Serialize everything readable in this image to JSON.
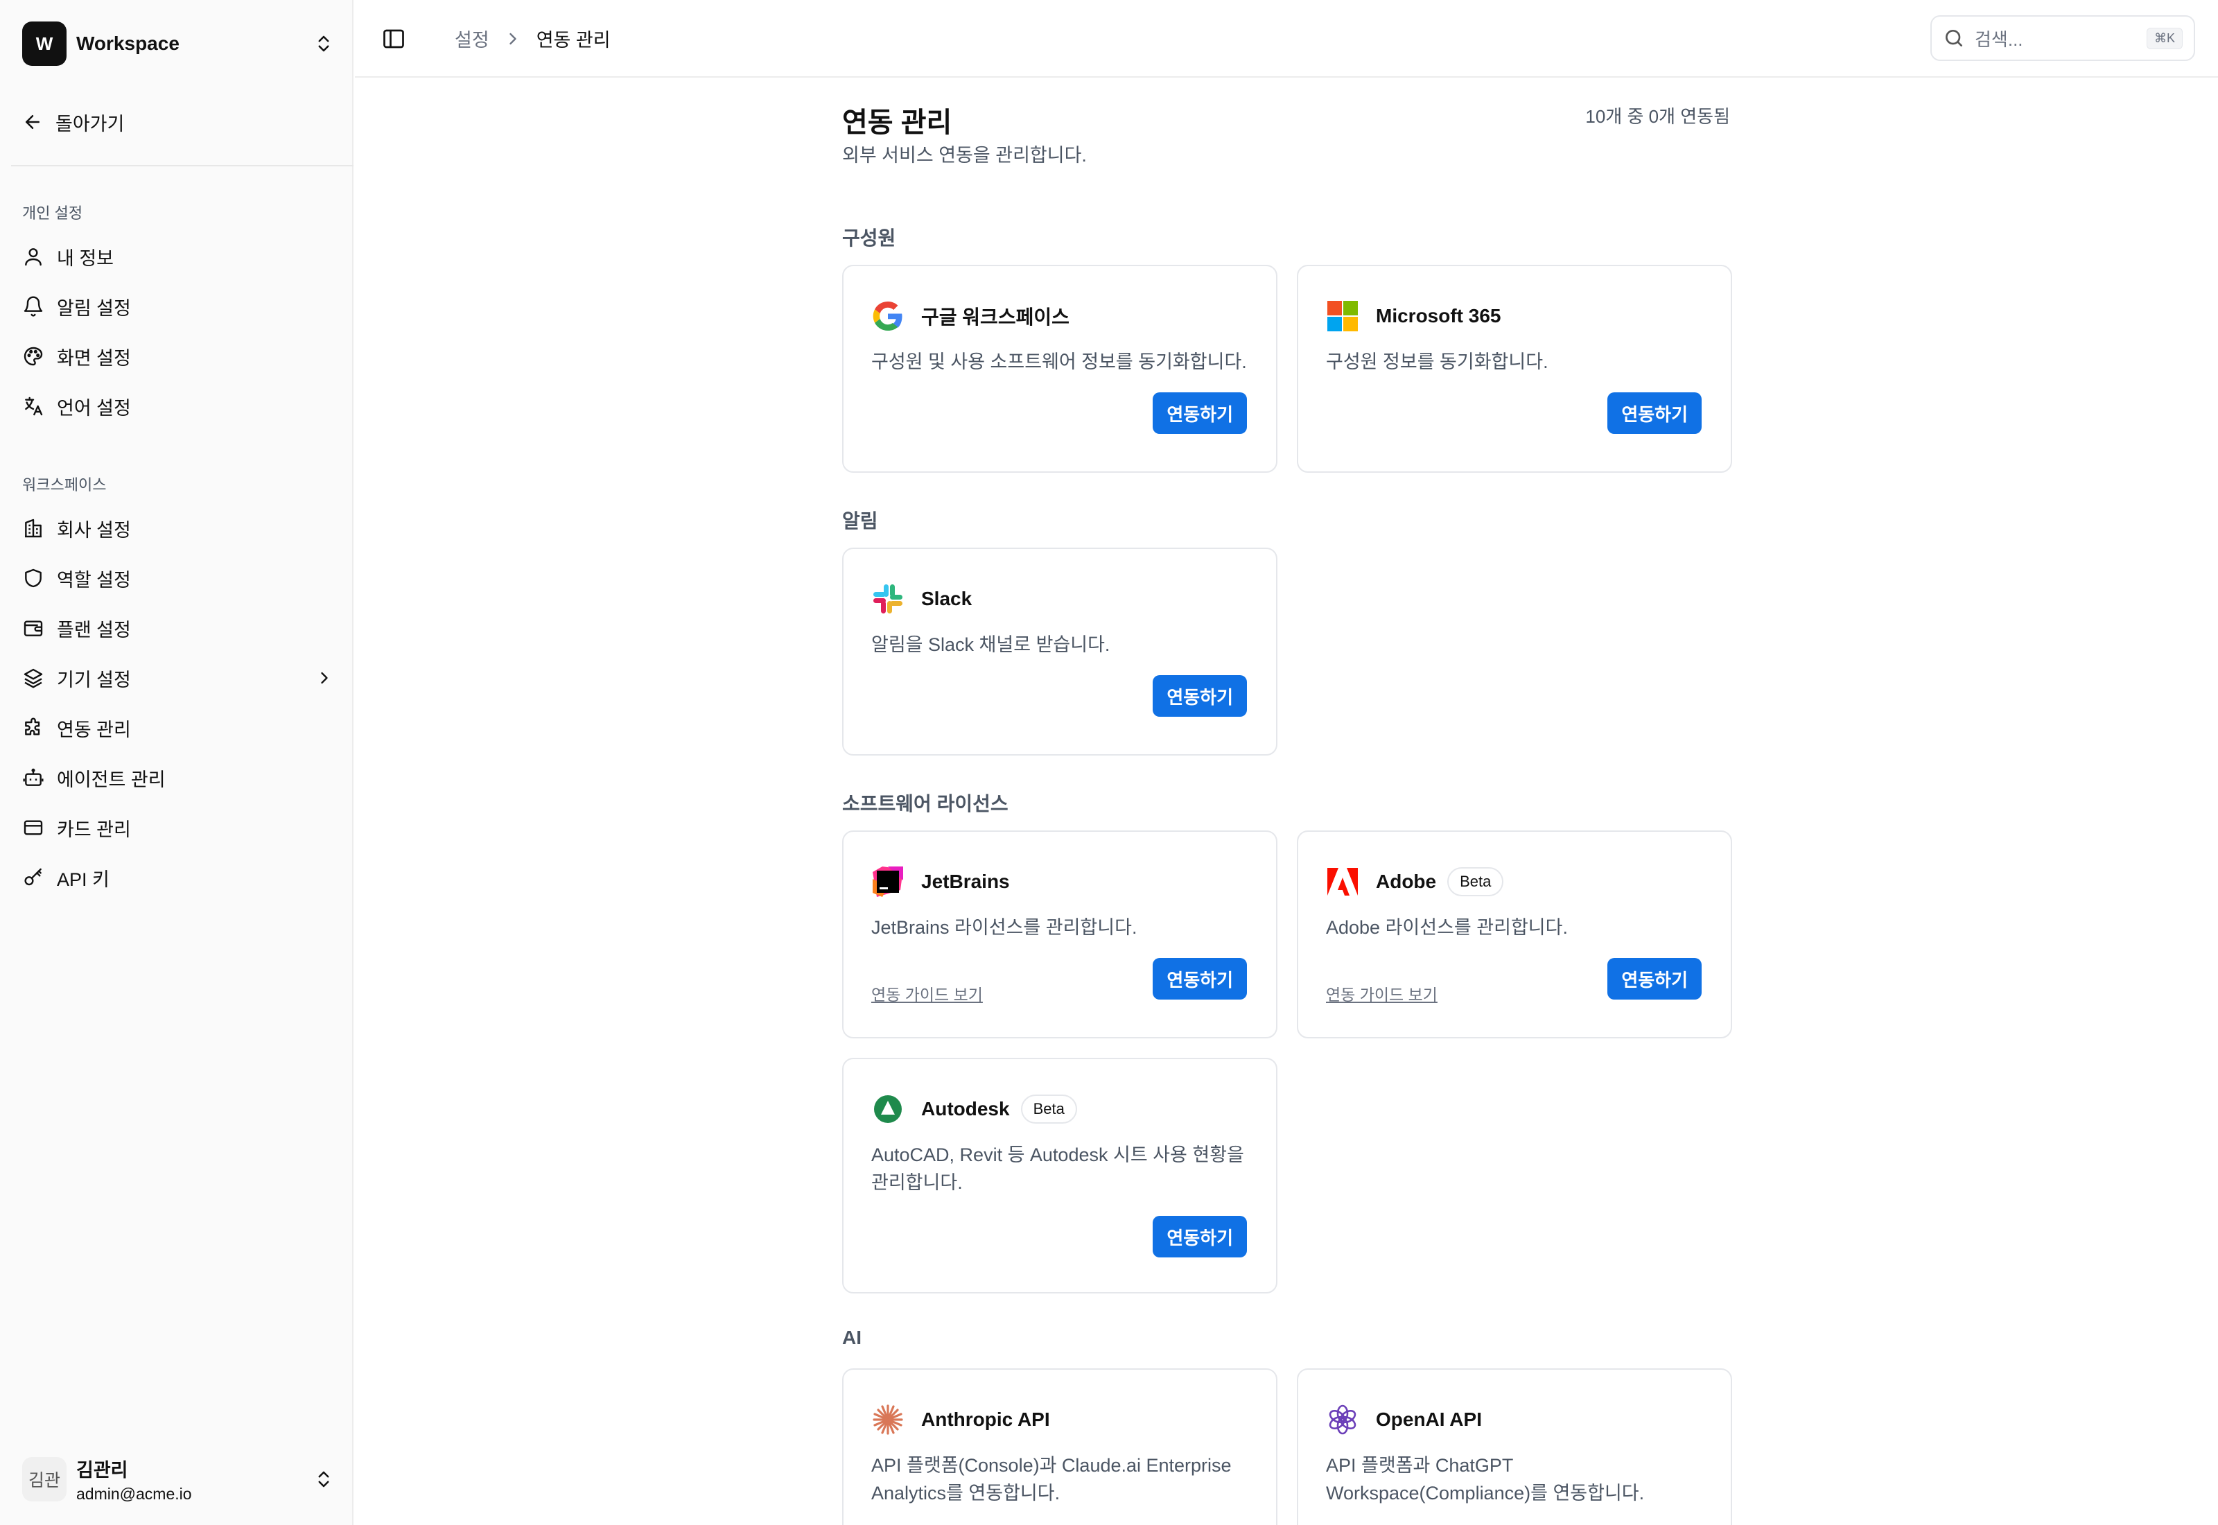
{
  "workspace": {
    "logo_letter": "W",
    "name": "Workspace"
  },
  "sidebar": {
    "back_label": "돌아가기",
    "personal_group": "개인 설정",
    "personal_items": [
      {
        "label": "내 정보",
        "icon": "user-icon"
      },
      {
        "label": "알림 설정",
        "icon": "bell-icon"
      },
      {
        "label": "화면 설정",
        "icon": "palette-icon"
      },
      {
        "label": "언어 설정",
        "icon": "language-icon"
      }
    ],
    "workspace_group": "워크스페이스",
    "workspace_items": [
      {
        "label": "회사 설정",
        "icon": "building-icon"
      },
      {
        "label": "역할 설정",
        "icon": "shield-icon"
      },
      {
        "label": "플랜 설정",
        "icon": "wallet-icon"
      },
      {
        "label": "기기 설정",
        "icon": "layers-icon"
      },
      {
        "label": "연동 관리",
        "icon": "puzzle-icon"
      },
      {
        "label": "에이전트 관리",
        "icon": "bot-icon"
      },
      {
        "label": "카드 관리",
        "icon": "credit-card-icon"
      },
      {
        "label": "API 키",
        "icon": "key-icon"
      }
    ],
    "user": {
      "avatar_text": "김관",
      "name": "김관리",
      "email": "admin@acme.io"
    }
  },
  "header": {
    "breadcrumb": [
      "설정",
      "연동 관리"
    ],
    "search_placeholder": "검색...",
    "search_shortcut": "⌘K"
  },
  "main": {
    "title": "연동 관리",
    "subtitle": "외부 서비스 연동을 관리합니다.",
    "count_text": "10개 중 0개 연동됨",
    "sections": [
      "구성원",
      "알림",
      "소프트웨어 라이선스",
      "AI"
    ],
    "connect_label": "연동하기",
    "guide_label": "연동 가이드 보기",
    "beta_label": "Beta",
    "cards": [
      {
        "name": "구글 워크스페이스",
        "desc": "구성원 및 사용 소프트웨어 정보를 동기화합니다.",
        "icon": "google-icon"
      },
      {
        "name": "Microsoft 365",
        "desc": "구성원 정보를 동기화합니다.",
        "icon": "microsoft-icon"
      },
      {
        "name": "Slack",
        "desc": "알림을 Slack 채널로 받습니다.",
        "icon": "slack-icon"
      },
      {
        "name": "JetBrains",
        "desc": "JetBrains 라이선스를 관리합니다.",
        "icon": "jetbrains-icon"
      },
      {
        "name": "Adobe",
        "desc": "Adobe 라이선스를 관리합니다.",
        "icon": "adobe-icon"
      },
      {
        "name": "Autodesk",
        "desc": "AutoCAD, Revit 등 Autodesk 시트 사용 현황을 관리합니다.",
        "icon": "autodesk-icon"
      },
      {
        "name": "Anthropic API",
        "desc": "API 플랫폼(Console)과 Claude.ai Enterprise Analytics를 연동합니다.",
        "icon": "anthropic-icon"
      },
      {
        "name": "OpenAI API",
        "desc": "API 플랫폼과 ChatGPT Workspace(Compliance)를 연동합니다.",
        "icon": "openai-icon"
      }
    ]
  },
  "colors": {
    "accent": "#1071e5",
    "border": "#e5e7eb",
    "sidebar_bg": "#fafafa"
  }
}
